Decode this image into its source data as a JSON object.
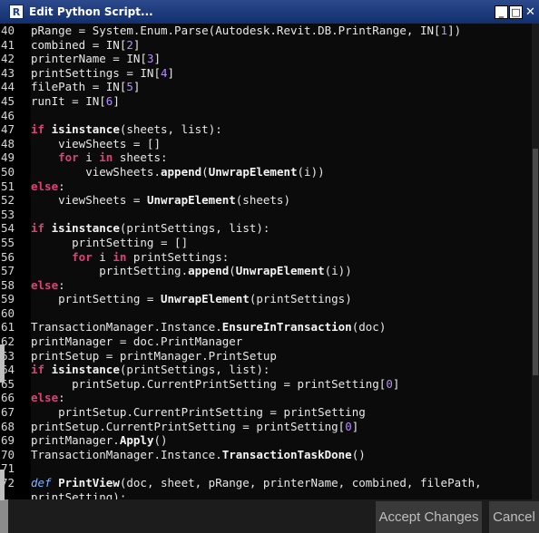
{
  "window": {
    "title": "Edit Python Script...",
    "app_icon_glyph": "R",
    "controls": {
      "minimize": "_",
      "maximize": "□",
      "close": "✕"
    }
  },
  "editor": {
    "lines": [
      {
        "n": "40",
        "tokens": [
          [
            "plain",
            "pRange = System.Enum.Parse(Autodesk.Revit.DB.PrintRange, IN["
          ],
          [
            "num",
            "1"
          ],
          [
            "plain",
            "])"
          ]
        ]
      },
      {
        "n": "41",
        "tokens": [
          [
            "plain",
            "combined = IN["
          ],
          [
            "num",
            "2"
          ],
          [
            "plain",
            "]"
          ]
        ]
      },
      {
        "n": "42",
        "tokens": [
          [
            "plain",
            "printerName = IN["
          ],
          [
            "num",
            "3"
          ],
          [
            "plain",
            "]"
          ]
        ]
      },
      {
        "n": "43",
        "tokens": [
          [
            "plain",
            "printSettings = IN["
          ],
          [
            "num",
            "4"
          ],
          [
            "plain",
            "]"
          ]
        ]
      },
      {
        "n": "44",
        "tokens": [
          [
            "plain",
            "filePath = IN["
          ],
          [
            "num",
            "5"
          ],
          [
            "plain",
            "]"
          ]
        ]
      },
      {
        "n": "45",
        "tokens": [
          [
            "plain",
            "runIt = IN["
          ],
          [
            "num",
            "6"
          ],
          [
            "plain",
            "]"
          ]
        ]
      },
      {
        "n": "46",
        "tokens": []
      },
      {
        "n": "47",
        "tokens": [
          [
            "kw",
            "if"
          ],
          [
            "plain",
            " "
          ],
          [
            "fn",
            "isinstance"
          ],
          [
            "plain",
            "(sheets, list):"
          ]
        ]
      },
      {
        "n": "48",
        "tokens": [
          [
            "plain",
            "    viewSheets = []"
          ]
        ]
      },
      {
        "n": "49",
        "tokens": [
          [
            "plain",
            "    "
          ],
          [
            "kw",
            "for"
          ],
          [
            "plain",
            " i "
          ],
          [
            "kw",
            "in"
          ],
          [
            "plain",
            " sheets:"
          ]
        ]
      },
      {
        "n": "50",
        "tokens": [
          [
            "plain",
            "        viewSheets."
          ],
          [
            "fn",
            "append"
          ],
          [
            "plain",
            "("
          ],
          [
            "fn",
            "UnwrapElement"
          ],
          [
            "plain",
            "(i))"
          ]
        ]
      },
      {
        "n": "51",
        "tokens": [
          [
            "kw",
            "else"
          ],
          [
            "plain",
            ":"
          ]
        ]
      },
      {
        "n": "52",
        "tokens": [
          [
            "plain",
            "    viewSheets = "
          ],
          [
            "fn",
            "UnwrapElement"
          ],
          [
            "plain",
            "(sheets)"
          ]
        ]
      },
      {
        "n": "53",
        "tokens": []
      },
      {
        "n": "54",
        "tokens": [
          [
            "kw",
            "if"
          ],
          [
            "plain",
            " "
          ],
          [
            "fn",
            "isinstance"
          ],
          [
            "plain",
            "(printSettings, list):"
          ]
        ]
      },
      {
        "n": "55",
        "tokens": [
          [
            "plain",
            "      printSetting = []"
          ]
        ]
      },
      {
        "n": "56",
        "tokens": [
          [
            "plain",
            "      "
          ],
          [
            "kw",
            "for"
          ],
          [
            "plain",
            " i "
          ],
          [
            "kw",
            "in"
          ],
          [
            "plain",
            " printSettings:"
          ]
        ]
      },
      {
        "n": "57",
        "tokens": [
          [
            "plain",
            "          printSetting."
          ],
          [
            "fn",
            "append"
          ],
          [
            "plain",
            "("
          ],
          [
            "fn",
            "UnwrapElement"
          ],
          [
            "plain",
            "(i))"
          ]
        ]
      },
      {
        "n": "58",
        "tokens": [
          [
            "kw",
            "else"
          ],
          [
            "plain",
            ":"
          ]
        ]
      },
      {
        "n": "59",
        "tokens": [
          [
            "plain",
            "    printSetting = "
          ],
          [
            "fn",
            "UnwrapElement"
          ],
          [
            "plain",
            "(printSettings)"
          ]
        ]
      },
      {
        "n": "60",
        "tokens": []
      },
      {
        "n": "61",
        "tokens": [
          [
            "plain",
            "TransactionManager.Instance."
          ],
          [
            "fn",
            "EnsureInTransaction"
          ],
          [
            "plain",
            "(doc)"
          ]
        ]
      },
      {
        "n": "62",
        "tokens": [
          [
            "plain",
            "printManager = doc.PrintManager"
          ]
        ]
      },
      {
        "n": "63",
        "tokens": [
          [
            "plain",
            "printSetup = printManager.PrintSetup"
          ]
        ]
      },
      {
        "n": "64",
        "tokens": [
          [
            "kw",
            "if"
          ],
          [
            "plain",
            " "
          ],
          [
            "fn",
            "isinstance"
          ],
          [
            "plain",
            "(printSettings, list):"
          ]
        ]
      },
      {
        "n": "65",
        "tokens": [
          [
            "plain",
            "      printSetup.CurrentPrintSetting = printSetting["
          ],
          [
            "num",
            "0"
          ],
          [
            "plain",
            "]"
          ]
        ]
      },
      {
        "n": "66",
        "tokens": [
          [
            "kw",
            "else"
          ],
          [
            "plain",
            ":"
          ]
        ]
      },
      {
        "n": "67",
        "tokens": [
          [
            "plain",
            "    printSetup.CurrentPrintSetting = printSetting"
          ]
        ]
      },
      {
        "n": "68",
        "tokens": [
          [
            "plain",
            "printSetup.CurrentPrintSetting = printSetting["
          ],
          [
            "num",
            "0"
          ],
          [
            "plain",
            "]"
          ]
        ]
      },
      {
        "n": "69",
        "tokens": [
          [
            "plain",
            "printManager."
          ],
          [
            "fn",
            "Apply"
          ],
          [
            "plain",
            "()"
          ]
        ]
      },
      {
        "n": "70",
        "tokens": [
          [
            "plain",
            "TransactionManager.Instance."
          ],
          [
            "fn",
            "TransactionTaskDone"
          ],
          [
            "plain",
            "()"
          ]
        ]
      },
      {
        "n": "71",
        "tokens": []
      },
      {
        "n": "72",
        "tokens": [
          [
            "def",
            "def"
          ],
          [
            "plain",
            " "
          ],
          [
            "fn",
            "PrintView"
          ],
          [
            "plain",
            "(doc, sheet, pRange, printerName, combined, filePath,"
          ]
        ]
      },
      {
        "n": "",
        "tokens": [
          [
            "plain",
            "printSetting):"
          ]
        ]
      }
    ]
  },
  "footer": {
    "accept_label": "Accept Changes",
    "cancel_label": "Cancel"
  }
}
